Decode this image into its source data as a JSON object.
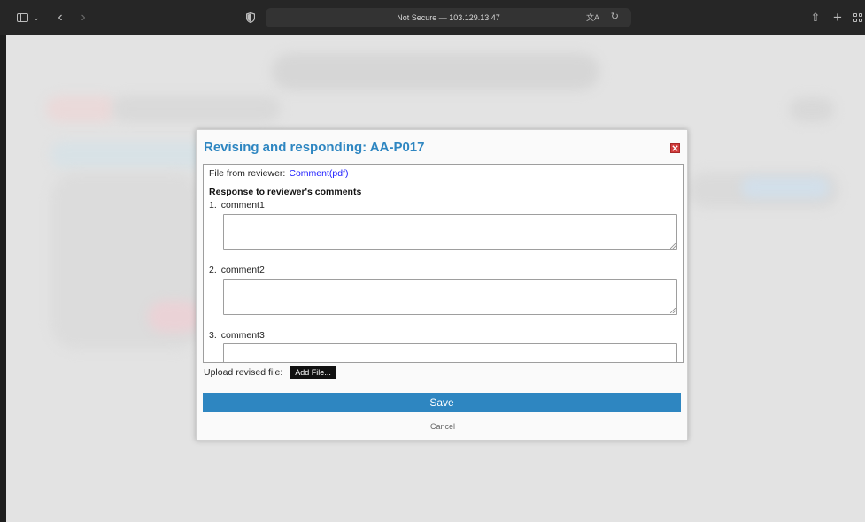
{
  "browser": {
    "address_text": "Not Secure — 103.129.13.47"
  },
  "modal": {
    "title": "Revising and responding: AA-P017",
    "reviewer_label": "File from reviewer:",
    "reviewer_link": "Comment(pdf)",
    "response_heading": "Response to reviewer's comments",
    "comments": [
      {
        "number": "1.",
        "label": "comment1",
        "value": ""
      },
      {
        "number": "2.",
        "label": "comment2",
        "value": ""
      },
      {
        "number": "3.",
        "label": "comment3",
        "value": ""
      }
    ],
    "upload_label": "Upload revised file:",
    "add_file_label": "Add File...",
    "save_label": "Save",
    "cancel_label": "Cancel"
  },
  "colors": {
    "accent": "#2e86c1",
    "close": "#d13c3c",
    "page_background": "#e3e3e3"
  }
}
